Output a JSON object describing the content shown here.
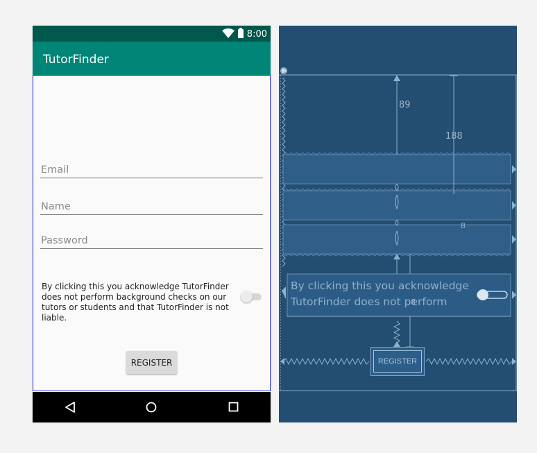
{
  "status_bar": {
    "time": "8:00",
    "wifi_icon": "wifi-icon",
    "battery_icon": "battery-icon"
  },
  "app_bar": {
    "title": "TutorFinder"
  },
  "form": {
    "email_hint": "Email",
    "name_hint": "Name",
    "password_hint": "Password",
    "disclaimer": "By clicking this you acknowledge TutorFinder does not perform background checks on our tutors or students and that TutorFinder is not liable.",
    "switch_checked": false,
    "register_label": "REGISTER"
  },
  "nav_bar": {
    "back_icon": "back-triangle-icon",
    "home_icon": "home-circle-icon",
    "recents_icon": "recents-square-icon"
  },
  "blueprint": {
    "dimension_top": "89",
    "dimension_right": "188",
    "dimension_small": "8",
    "dimension_mid": "8",
    "disclaimer_preview_line1": "By clicking this you acknowledge",
    "disclaimer_preview_line2": "TutorFinder does not perform",
    "register_label": "REGISTER"
  },
  "colors": {
    "status_bar": "#00574b",
    "app_bar": "#008577",
    "content_border": "#1f2bd6",
    "blueprint_bg": "#234e72",
    "blueprint_line": "#8fb0cc"
  }
}
